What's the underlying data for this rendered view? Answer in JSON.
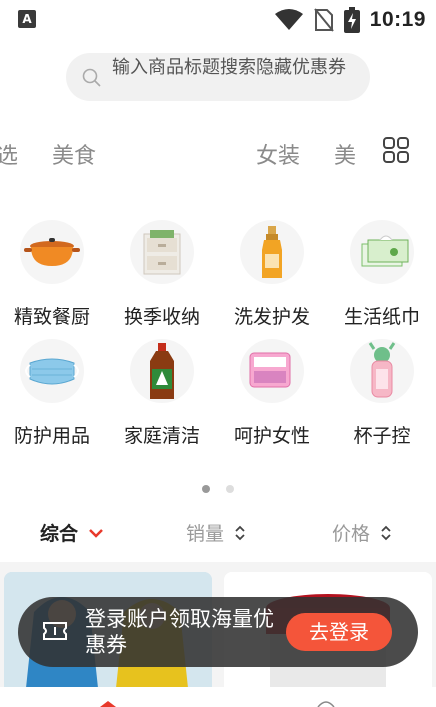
{
  "status": {
    "app_badge": "A",
    "time": "10:19",
    "icons": [
      "wifi-icon",
      "no-sim-icon",
      "battery-charging-icon"
    ]
  },
  "search": {
    "placeholder": "输入商品标题搜索隐藏优惠券"
  },
  "top_categories": [
    "选",
    "美食",
    "女装",
    "美"
  ],
  "category_grid": [
    {
      "label": "精致餐厨",
      "icon": "casserole-pot-icon"
    },
    {
      "label": "换季收纳",
      "icon": "storage-box-icon"
    },
    {
      "label": "洗发护发",
      "icon": "shampoo-bottle-icon"
    },
    {
      "label": "生活纸巾",
      "icon": "tissue-box-icon"
    },
    {
      "label": "防护用品",
      "icon": "face-mask-icon"
    },
    {
      "label": "家庭清洁",
      "icon": "disinfectant-bottle-icon"
    },
    {
      "label": "呵护女性",
      "icon": "sanitary-pad-icon"
    },
    {
      "label": "杯子控",
      "icon": "water-cup-icon"
    }
  ],
  "pager": {
    "active_index": 0,
    "count": 2
  },
  "sort_bar": {
    "comprehensive": "综合",
    "sales": "销量",
    "price": "价格"
  },
  "login_toast": {
    "text": "登录账户领取海量优惠券",
    "button": "去登录"
  },
  "colors": {
    "accent": "#f4553a",
    "sort_active_arrow": "#e8392b"
  }
}
